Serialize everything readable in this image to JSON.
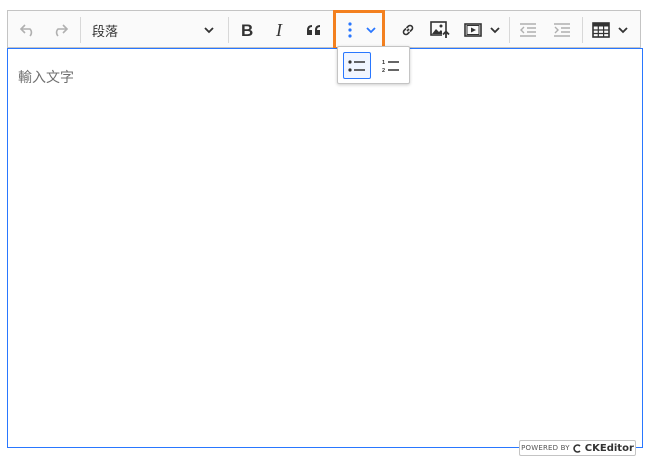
{
  "toolbar": {
    "heading_value": "段落",
    "buttons": [
      "undo-button",
      "redo-button",
      "bold-button",
      "italic-button",
      "blockquote-button",
      "list-dropdown-button",
      "link-button",
      "image-upload-button",
      "media-embed-button",
      "outdent-button",
      "indent-button",
      "table-button"
    ]
  },
  "editor": {
    "placeholder": "輸入文字"
  },
  "list_dropdown": {
    "items": [
      "bulleted-list",
      "numbered-list"
    ],
    "active": "bulleted-list"
  },
  "footer": {
    "powered_by": "POWERED BY",
    "brand": "CKEditor"
  },
  "colors": {
    "highlight": "#f3801f",
    "focus": "#2977ff"
  }
}
